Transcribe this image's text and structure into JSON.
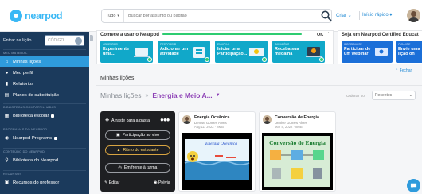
{
  "app": {
    "logo_text": "nearpod"
  },
  "topbar": {
    "search_filter": "Tudo",
    "search_placeholder": "Buscar por assunto ou padrão",
    "create_label": "Criar",
    "quick_start_label": "Início rápido",
    "icons": {
      "search": "search-icon",
      "chevron": "chevron-down-icon",
      "rocket": "rocket-icon"
    }
  },
  "sidebar": {
    "login_label": "Entrar na lição",
    "code_placeholder": "CÓDIGO...",
    "sections": {
      "my_material": "MEU MATERIAL",
      "district": "BIBLIOTECAS COMPARTILHADAS",
      "programs": "PROGRAMAS DO NEARPOD",
      "content": "CONTEÚDO DO NEARPOD",
      "resources": "RECURSOS"
    },
    "items": [
      {
        "label": "Minhas lições",
        "icon": "home-icon",
        "active": true
      },
      {
        "label": "Meu perfil",
        "icon": "user-icon",
        "active": false
      },
      {
        "label": "Relatórios",
        "icon": "chart-icon",
        "active": false
      },
      {
        "label": "Planos de substituição",
        "icon": "book-icon",
        "active": false
      },
      {
        "label": "Biblioteca escolar",
        "icon": "library-icon",
        "active": false
      },
      {
        "label": "Nearpod Programs",
        "icon": "programs-icon",
        "active": false
      },
      {
        "label": "Biblioteca do Nearpod",
        "icon": "search-icon",
        "active": false
      },
      {
        "label": "Recursos do professor",
        "icon": "resources-icon",
        "active": false
      }
    ]
  },
  "banner": {
    "title": "Comece a usar o Nearpod",
    "ok_label": "OK",
    "cards": [
      {
        "tag": "APRENDER",
        "title": "Experimente uma...",
        "color": "#11a8c9"
      },
      {
        "tag": "DESCOBRIR",
        "title": "Adicionar um atividade",
        "color": "#11a8c9"
      },
      {
        "tag": "ENVOLVA",
        "title": "Iniciar uma Participação...",
        "color": "#11a8c9"
      },
      {
        "tag": "PARABÉNS",
        "title": "Receba sua medalha",
        "color": "#11a8c9"
      }
    ]
  },
  "banner2": {
    "title": "Seja um Nearpod Certified Educat",
    "cards": [
      {
        "tag": "INSCREVA-SE",
        "title": "Participar de um webinar",
        "color": "#1b6fd8"
      },
      {
        "tag": "CONVIDE",
        "title": "Envie uma lição on",
        "color": "#1b6fd8"
      }
    ],
    "hide_label": "Fechar"
  },
  "content": {
    "heading": "Minhas lições",
    "breadcrumb_root": "Minhas lições",
    "breadcrumb_current": "Energia e Meio A...",
    "sort_label": "Ordenar por",
    "sort_value": "Recentes"
  },
  "selected_card": {
    "move_label": "Arraste para a pasta",
    "live_label": "Participação ao vivo",
    "student_label": "Ritmo do estudante",
    "front_label": "Em frente à turma",
    "edit_label": "Editar",
    "preview_label": "Prévia"
  },
  "lessons": [
    {
      "title": "Energia Oceânica",
      "author": "Denise Gomes Alves",
      "date": "Aug 11, 2022 · 8MB",
      "thumb_text": "Energia Oceânica"
    },
    {
      "title": "Conversão de Energia",
      "author": "Denise Gomes Alves",
      "date": "Mar 4, 2022 · 8MB",
      "thumb_text": "Conversão de Energia"
    }
  ],
  "colors": {
    "sidebar_bg": "#1b3a5c",
    "active_item": "#2f9bdc",
    "accent_purple": "#8c3fb5",
    "banner_teal": "#11a8c9",
    "banner_blue": "#1b6fd8"
  }
}
